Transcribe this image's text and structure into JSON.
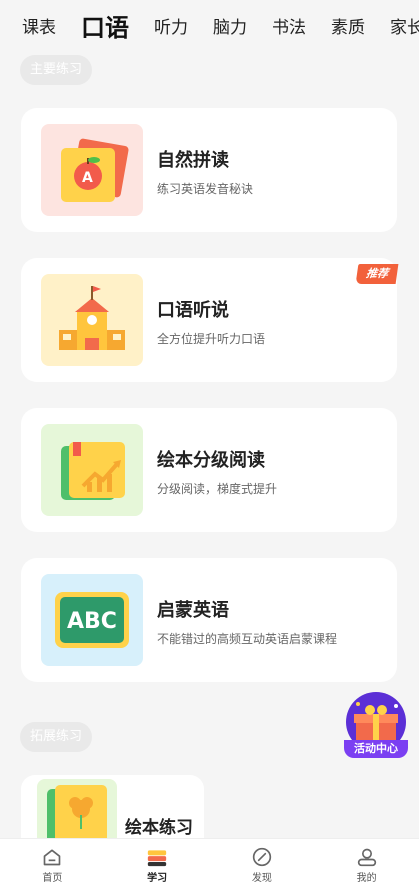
{
  "top_tabs": [
    "课表",
    "口语",
    "听力",
    "脑力",
    "书法",
    "素质",
    "家长"
  ],
  "active_tab_index": 1,
  "sections": {
    "main": "主要练习",
    "extended": "拓展练习"
  },
  "cards": [
    {
      "title": "自然拼读",
      "subtitle": "练习英语发音秘诀",
      "icon": "apple-flashcard-icon"
    },
    {
      "title": "口语听说",
      "subtitle": "全方位提升听力口语",
      "icon": "school-building-icon",
      "badge": "推荐"
    },
    {
      "title": "绘本分级阅读",
      "subtitle": "分级阅读，梯度式提升",
      "icon": "growth-book-icon"
    },
    {
      "title": "启蒙英语",
      "subtitle": "不能错过的高频互动英语启蒙课程",
      "icon": "abc-board-icon",
      "board_text": "ABC"
    }
  ],
  "extended_cards": [
    {
      "title": "绘本练习",
      "icon": "flower-book-icon"
    }
  ],
  "activity_button": {
    "label": "活动中心",
    "icon": "gift-box-icon"
  },
  "bottom_nav": [
    {
      "label": "首页",
      "icon": "home-icon"
    },
    {
      "label": "学习",
      "icon": "books-icon"
    },
    {
      "label": "发现",
      "icon": "compass-icon"
    },
    {
      "label": "我的",
      "icon": "profile-icon"
    }
  ],
  "active_nav_index": 1,
  "colors": {
    "badge": "#f2613b",
    "activity": "#7b3ff2",
    "abc_board": "#2e9a6a"
  }
}
